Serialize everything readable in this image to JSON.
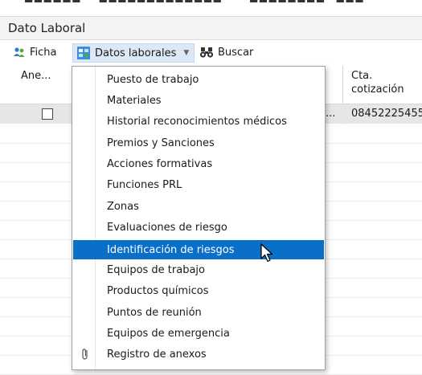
{
  "section_title": "Dato Laboral",
  "toolbar": {
    "ficha_label": "Ficha",
    "datos_laborales_label": "Datos laborales",
    "buscar_label": "Buscar"
  },
  "grid": {
    "columns": [
      "Ane...",
      "Cta.",
      "cotización"
    ],
    "row": {
      "truncated": "...",
      "cta_cotizacion": "08452225455"
    }
  },
  "menu": {
    "items": [
      "Puesto de trabajo",
      "Materiales",
      "Historial reconocimientos médicos",
      "Premios y Sanciones",
      "Acciones formativas",
      "Funciones PRL",
      "Zonas",
      "Evaluaciones de riesgo",
      "Identificación de riesgos",
      "Equipos de trabajo",
      "Productos químicos",
      "Puntos de reunión",
      "Equipos de emergencia",
      "Registro de anexos"
    ],
    "selected_index": 8,
    "attachment_item_icon": "paperclip-icon"
  },
  "colors": {
    "selected_bg": "#0a6fc9",
    "active_button_bg": "#dbe9f7",
    "row_highlight": "#e6e6e6"
  }
}
